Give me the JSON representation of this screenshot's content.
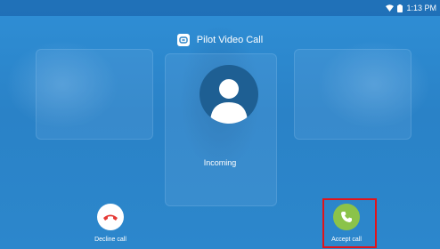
{
  "status_bar": {
    "time": "1:13 PM",
    "icons": [
      "wifi-icon",
      "battery-icon"
    ]
  },
  "header": {
    "app_icon": "pilot-video-call-icon",
    "title": "Pilot Video Call"
  },
  "caller": {
    "avatar_icon": "person-silhouette-icon",
    "status": "Incoming"
  },
  "actions": {
    "decline": {
      "label": "Decline call",
      "icon": "phone-hangup-icon",
      "color": "#ffffff",
      "icon_color": "#e53935"
    },
    "accept": {
      "label": "Accept call",
      "icon": "phone-icon",
      "color": "#8bc34a",
      "icon_color": "#ffffff"
    }
  },
  "annotation": {
    "highlight_color": "#e0141b"
  }
}
